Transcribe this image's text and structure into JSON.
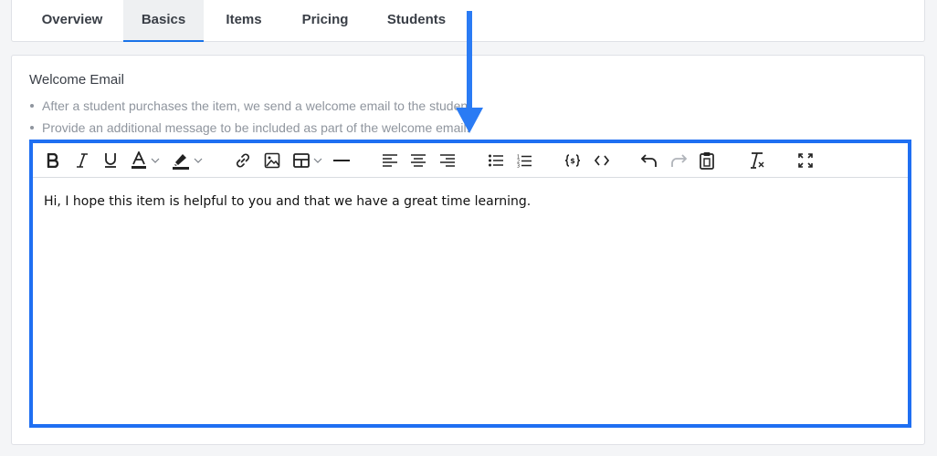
{
  "tabs": [
    {
      "label": "Overview",
      "active": false
    },
    {
      "label": "Basics",
      "active": true
    },
    {
      "label": "Items",
      "active": false
    },
    {
      "label": "Pricing",
      "active": false
    },
    {
      "label": "Students",
      "active": false
    }
  ],
  "section": {
    "title": "Welcome Email",
    "bullets": [
      "After a student purchases the item, we send a welcome email to the student.",
      "Provide an additional message to be included as part of the welcome email."
    ]
  },
  "editor": {
    "content": "Hi, I hope this item is helpful to you and that we have a great time learning.",
    "toolbar_icons": [
      "bold-icon",
      "italic-icon",
      "underline-icon",
      "text-color-icon",
      "chevron-down-icon",
      "highlight-color-icon",
      "chevron-down-icon",
      "link-icon",
      "image-icon",
      "table-icon",
      "chevron-down-icon",
      "horizontal-rule-icon",
      "align-left-icon",
      "align-center-icon",
      "align-right-icon",
      "bullet-list-icon",
      "numbered-list-icon",
      "variable-icon",
      "code-icon",
      "undo-icon",
      "redo-icon",
      "paste-icon",
      "clear-formatting-icon",
      "fullscreen-icon"
    ]
  },
  "colors": {
    "accent": "#1a73e8",
    "editor_border": "#1f6ff2",
    "arrow": "#2a7bf4"
  }
}
